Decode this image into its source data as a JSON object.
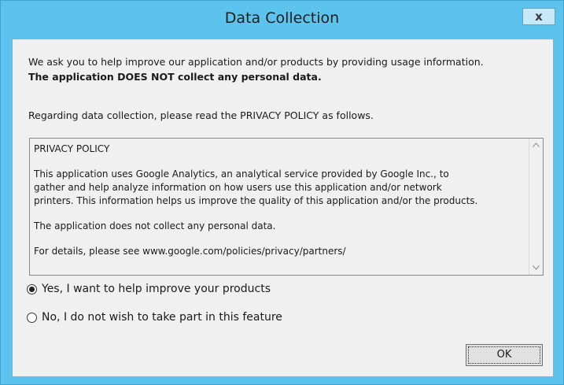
{
  "window": {
    "title": "Data Collection",
    "close_label": "x"
  },
  "intro": {
    "line1": "We ask you to help improve our application and/or products by providing usage information.",
    "line2": "The application DOES NOT collect any personal data."
  },
  "regarding": "Regarding data collection, please read the PRIVACY POLICY as follows.",
  "policy": {
    "heading": "PRIVACY POLICY",
    "para1_line1": "This application uses Google Analytics, an analytical service provided by Google Inc., to",
    "para1_line2": "gather and help analyze information on how users use this application and/or network",
    "para1_line3": "printers. This information helps us improve the quality of this application and/or the products.",
    "para2": "The application does not collect any personal data.",
    "para3": " For details, please see www.google.com/policies/privacy/partners/"
  },
  "scrollbar": {
    "up_icon": "chevron-up",
    "down_icon": "chevron-down"
  },
  "options": [
    {
      "label": "Yes, I want to help improve your products",
      "checked": true
    },
    {
      "label": "No, I do not wish to take part in this feature",
      "checked": false
    }
  ],
  "ok_label": "OK",
  "colors": {
    "frame": "#5bc3ee",
    "client": "#f0f0f0"
  }
}
